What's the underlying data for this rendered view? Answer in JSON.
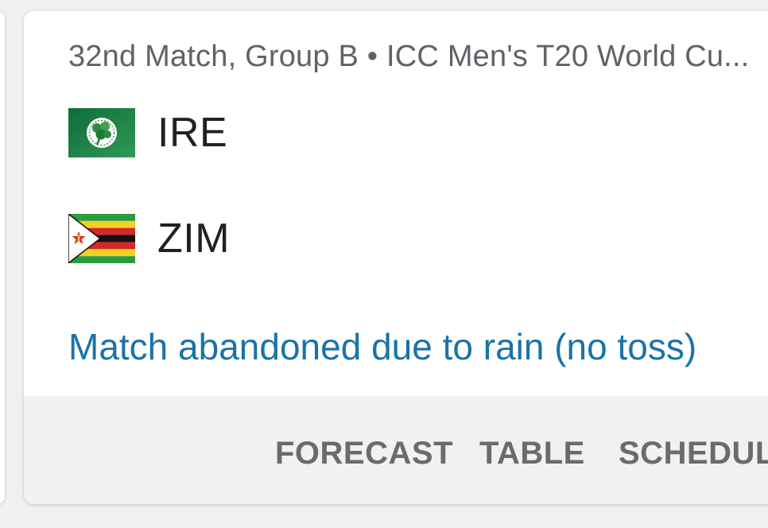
{
  "match": {
    "title": "32nd Match, Group B • ICC Men's T20 World Cu...",
    "teams": [
      {
        "code": "IRE",
        "flag_icon": "ireland-cricket-flag-icon"
      },
      {
        "code": "ZIM",
        "flag_icon": "zimbabwe-flag-icon"
      }
    ],
    "status": "Match abandoned due to rain (no toss)"
  },
  "footer": {
    "buttons": [
      "FORECAST",
      "TABLE",
      "SCHEDULE"
    ]
  },
  "colors": {
    "status_link": "#1a73a8",
    "title_text": "#5f6368",
    "team_text": "#202124",
    "footer_bg": "#f1f1f1",
    "footer_text": "#6b6b6b"
  }
}
